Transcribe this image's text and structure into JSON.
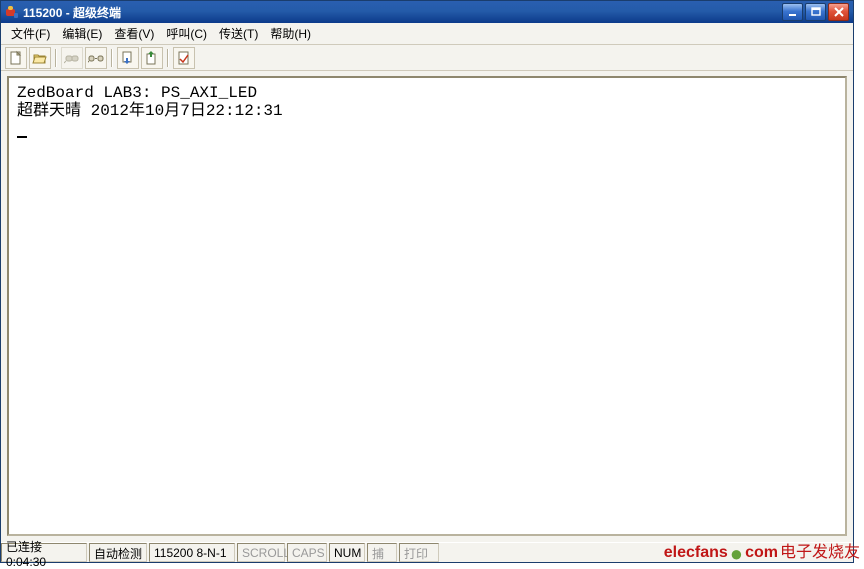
{
  "window": {
    "title": "115200 - 超级终端"
  },
  "menu": {
    "file": "文件(F)",
    "edit": "编辑(E)",
    "view": "查看(V)",
    "call": "呼叫(C)",
    "transfer": "传送(T)",
    "help": "帮助(H)"
  },
  "toolbar": {
    "new": "new",
    "open": "open",
    "connect": "connect",
    "disconnect": "disconnect",
    "send": "send",
    "receive": "receive",
    "properties": "properties"
  },
  "terminal": {
    "line1": "ZedBoard LAB3: PS_AXI_LED",
    "line2": "超群天晴 2012年10月7日22:12:31"
  },
  "status": {
    "connected": "已连接 0:04:30",
    "auto": "自动检测",
    "port": "115200 8-N-1",
    "scroll": "SCROLL",
    "caps": "CAPS",
    "num": "NUM",
    "capture": "捕",
    "print": "打印"
  },
  "watermark": {
    "brand": "elecfans",
    "dot": "●",
    "com": "com",
    "cn": " 电子发烧友"
  }
}
